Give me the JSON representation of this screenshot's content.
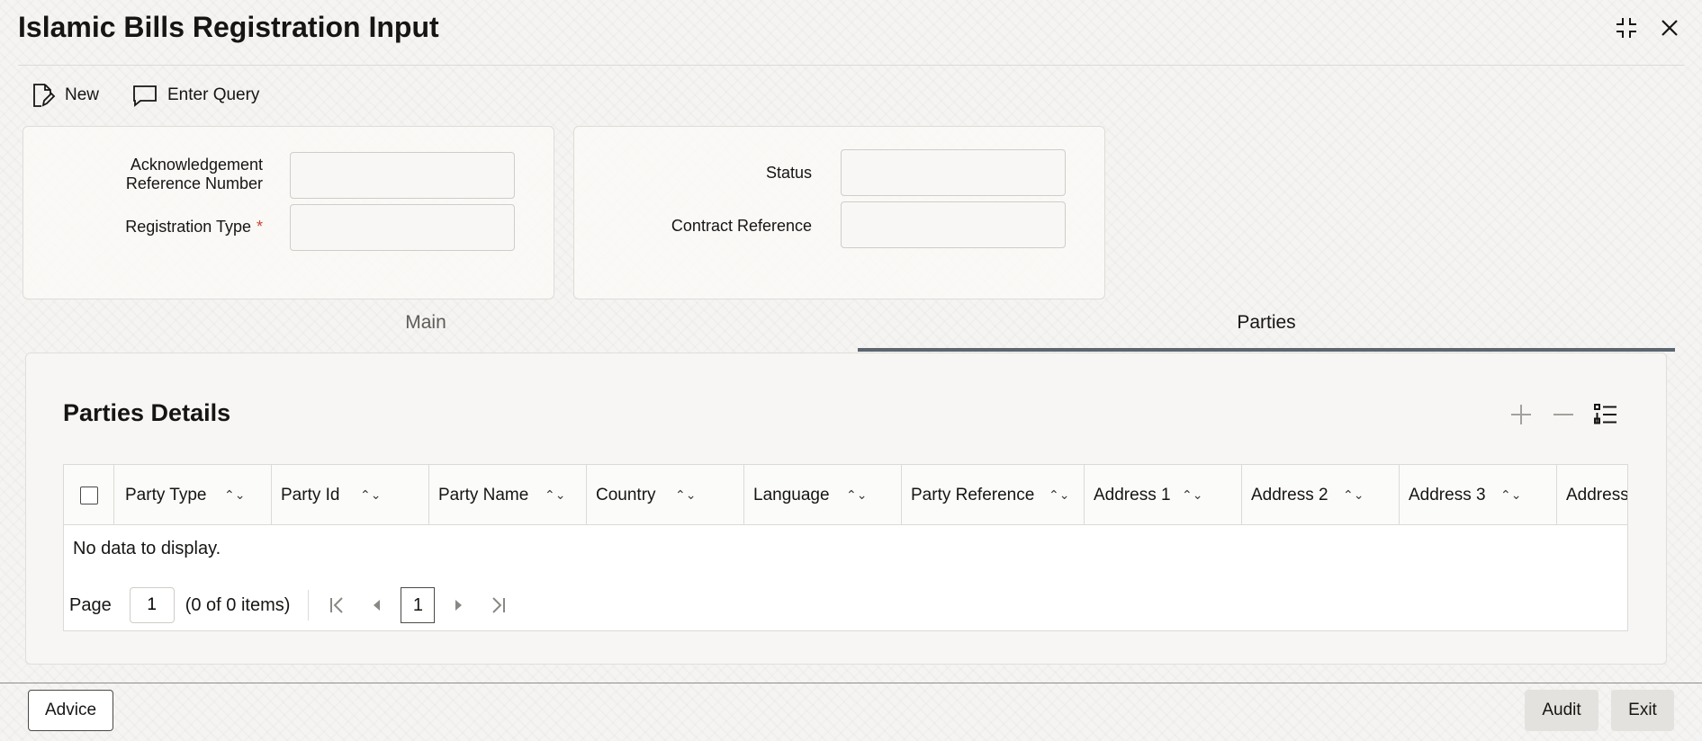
{
  "window": {
    "title": "Islamic Bills Registration Input"
  },
  "toolbar": {
    "new_label": "New",
    "enter_query_label": "Enter Query"
  },
  "form": {
    "ack_ref_label_line1": "Acknowledgement",
    "ack_ref_label_line2": "Reference Number",
    "ack_ref_value": "",
    "registration_type_label": "Registration Type",
    "required_mark": "*",
    "registration_type_value": "",
    "status_label": "Status",
    "status_value": "",
    "contract_reference_label": "Contract Reference",
    "contract_reference_value": ""
  },
  "tabs": [
    {
      "label": "Main",
      "active": false
    },
    {
      "label": "Parties",
      "active": true
    }
  ],
  "parties": {
    "section_title": "Parties Details",
    "columns": [
      "Party Type",
      "Party Id",
      "Party Name",
      "Country",
      "Language",
      "Party Reference",
      "Address 1",
      "Address 2",
      "Address 3",
      "Address"
    ],
    "rows": [],
    "empty_message": "No data to display.",
    "pager": {
      "page_label": "Page",
      "page_value": "1",
      "items_summary": "(0 of 0 items)",
      "current_page": "1"
    }
  },
  "footer": {
    "advice_label": "Advice",
    "audit_label": "Audit",
    "exit_label": "Exit"
  },
  "colors": {
    "accent": "#5c6670",
    "required": "#c74634",
    "background": "#f5f4f2"
  }
}
